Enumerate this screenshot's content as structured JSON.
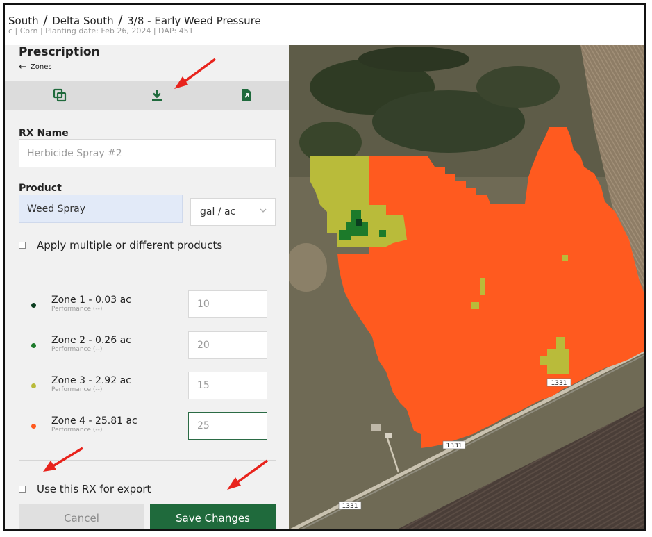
{
  "header": {
    "crumb_1": "South",
    "crumb_2": "Delta South",
    "crumb_3": "3/8 - Early Weed Pressure",
    "separator": "/",
    "subtitle": "c | Corn | Planting date: Feb 26, 2024 | DAP: 451"
  },
  "panel": {
    "title": "Prescription",
    "back_label": "Zones",
    "toolbar": {
      "icons": [
        "copy-icon",
        "download-icon",
        "export-file-icon"
      ]
    },
    "rx_name_label": "RX Name",
    "rx_name_placeholder": "Herbicide Spray #2",
    "product_label": "Product",
    "product_value": "Weed Spray",
    "unit_value": "gal / ac",
    "multi_products_label": "Apply multiple or different products",
    "zones": [
      {
        "name": "Zone 1 - 0.03 ac",
        "performance": "Performance (--)",
        "rate": "10",
        "color": "#0b3d1f"
      },
      {
        "name": "Zone 2 - 0.26 ac",
        "performance": "Performance (--)",
        "rate": "20",
        "color": "#1c7a2a"
      },
      {
        "name": "Zone 3 - 2.92 ac",
        "performance": "Performance (--)",
        "rate": "15",
        "color": "#b9bb3a"
      },
      {
        "name": "Zone 4 - 25.81 ac",
        "performance": "Performance (--)",
        "rate": "25",
        "color": "#ff5a1f"
      }
    ],
    "export_label": "Use this RX for export",
    "cancel_label": "Cancel",
    "save_label": "Save Changes"
  },
  "map": {
    "road_labels": [
      "1331",
      "1331",
      "1331"
    ]
  },
  "colors": {
    "accent_green": "#1f6a3c",
    "zone_orange": "#ff5a1f",
    "zone_olive": "#b9bb3a",
    "annotation_red": "#e8231c"
  }
}
